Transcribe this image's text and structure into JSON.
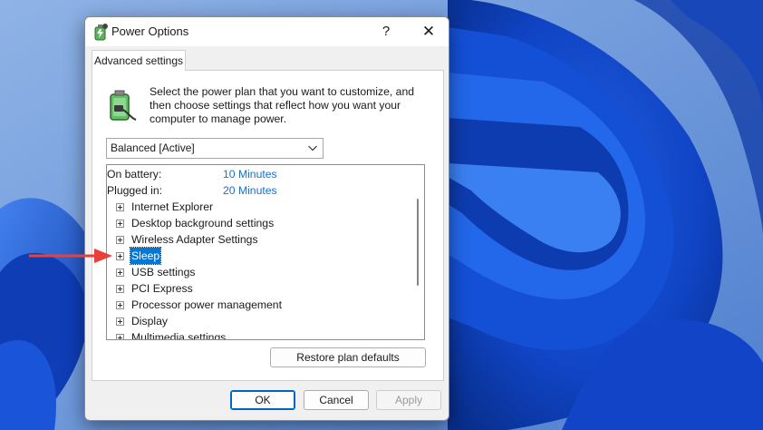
{
  "window": {
    "title": "Power Options",
    "help_glyph": "?",
    "close_glyph": "✕"
  },
  "tabs": [
    {
      "label": "Advanced settings"
    }
  ],
  "description": "Select the power plan that you want to customize, and then choose settings that reflect how you want your computer to manage power.",
  "plan_select": {
    "value": "Balanced [Active]"
  },
  "settings_tree": {
    "sub_settings": [
      {
        "label": "On battery:",
        "value": "10 Minutes"
      },
      {
        "label": "Plugged in:",
        "value": "20 Minutes"
      }
    ],
    "items": [
      {
        "label": "Internet Explorer"
      },
      {
        "label": "Desktop background settings"
      },
      {
        "label": "Wireless Adapter Settings"
      },
      {
        "label": "Sleep",
        "selected": true
      },
      {
        "label": "USB settings"
      },
      {
        "label": "PCI Express"
      },
      {
        "label": "Processor power management"
      },
      {
        "label": "Display"
      },
      {
        "label": "Multimedia settings"
      }
    ]
  },
  "buttons": {
    "restore": "Restore plan defaults",
    "ok": "OK",
    "cancel": "Cancel",
    "apply": "Apply",
    "apply_enabled": false
  },
  "annotation": {
    "arrow_color": "#e8403a",
    "points_to": "Sleep"
  },
  "colors": {
    "accent": "#0078d7",
    "link_value": "#1a6fc9",
    "wallpaper_dark": "#0b3aa8",
    "wallpaper_light": "#6f9ad8"
  },
  "icons": {
    "title": "power-options-icon",
    "battery": "battery-plug-icon",
    "dropdown": "chevron-down-icon",
    "expander": "plus-box-icon"
  }
}
